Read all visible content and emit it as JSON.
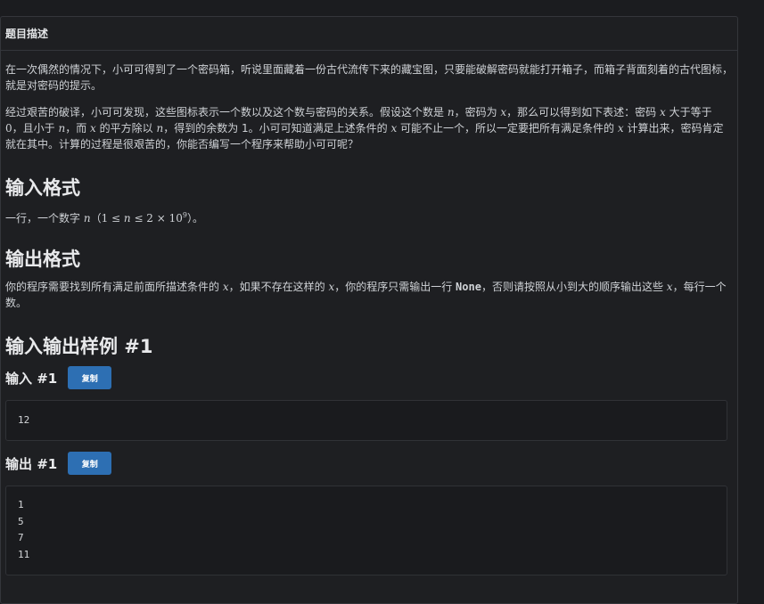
{
  "panel": {
    "title": "题目描述"
  },
  "description": {
    "p1": "在一次偶然的情况下，小可可得到了一个密码箱，听说里面藏着一份古代流传下来的藏宝图，只要能破解密码就能打开箱子，而箱子背面刻着的古代图标，就是对密码的提示。",
    "p2_a": "经过艰苦的破译，小可可发现，这些图标表示一个数以及这个数与密码的关系。假设这个数是 ",
    "p2_n1": "n",
    "p2_b": "，密码为 ",
    "p2_x1": "x",
    "p2_c": "，那么可以得到如下表述：密码 ",
    "p2_x2": "x",
    "p2_d": " 大于等于 ",
    "p2_zero": "0",
    "p2_e": "，且小于 ",
    "p2_n2": "n",
    "p2_f": "，而 ",
    "p2_x3": "x",
    "p2_g": " 的平方除以 ",
    "p2_n3": "n",
    "p2_h": "，得到的余数为 1。小可可知道满足上述条件的 ",
    "p2_x4": "x",
    "p2_i": " 可能不止一个，所以一定要把所有满足条件的 ",
    "p2_x5": "x",
    "p2_j": " 计算出来，密码肯定就在其中。计算的过程是很艰苦的，你能否编写一个程序来帮助小可可呢？"
  },
  "input_format": {
    "heading": "输入格式",
    "text_a": "一行，一个数字 ",
    "var_n": "n",
    "range_open": "（1 ≤ ",
    "range_n": "n",
    "range_mid": " ≤ 2 × 10",
    "range_exp": "9",
    "range_close": "）。"
  },
  "output_format": {
    "heading": "输出格式",
    "text_a": "你的程序需要找到所有满足前面所描述条件的 ",
    "x1": "x",
    "text_b": "，如果不存在这样的 ",
    "x2": "x",
    "text_c": "，你的程序只需输出一行 ",
    "none": "None",
    "text_d": "，否则请按照从小到大的顺序输出这些 ",
    "x3": "x",
    "text_e": "，每行一个数。"
  },
  "samples": {
    "heading": "输入输出样例 #1",
    "input_label": "输入 #1",
    "output_label": "输出 #1",
    "copy_label": "复制",
    "input_lines": [
      "12"
    ],
    "output_lines": [
      "1",
      "5",
      "7",
      "11"
    ]
  }
}
